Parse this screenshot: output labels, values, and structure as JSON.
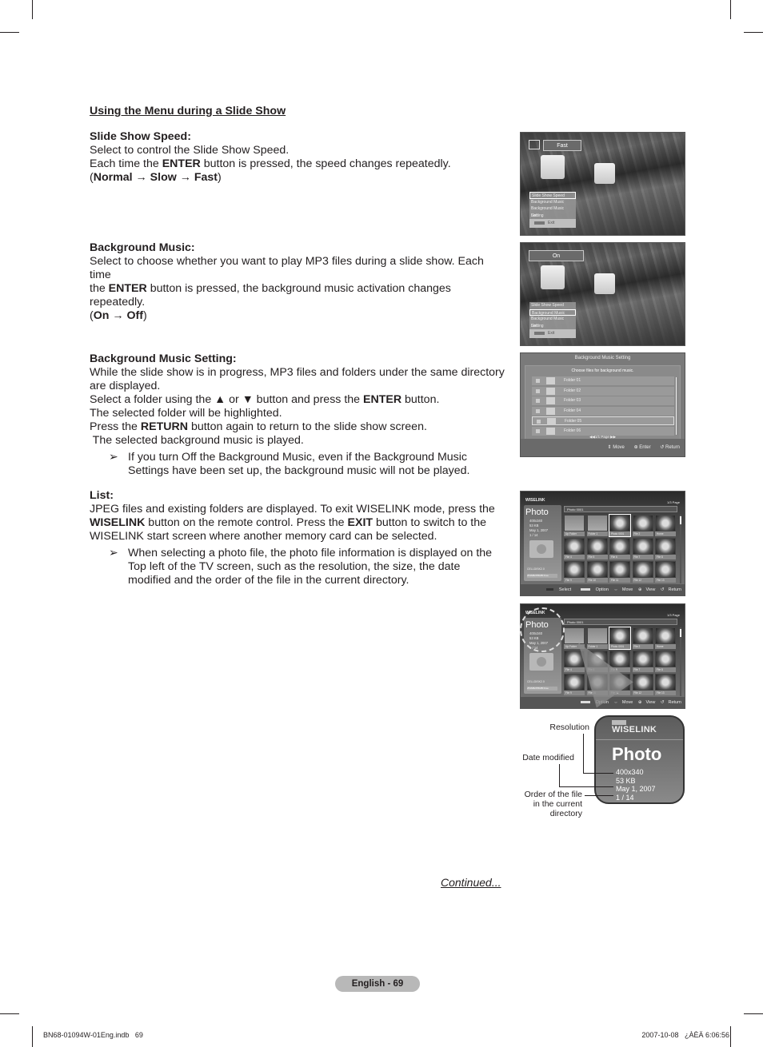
{
  "section_title": "Using the Menu during a Slide Show",
  "slide_show_speed": {
    "heading": "Slide Show Speed:",
    "line1": "Select to control the Slide Show Speed.",
    "line2_pre": "Each time the ",
    "line2_bold": "ENTER",
    "line2_post": " button is pressed, the speed changes repeatedly.",
    "cycle_open": "(",
    "cycle_bold": "Normal → Slow → Fast",
    "cycle_close": ")"
  },
  "background_music": {
    "heading": "Background Music:",
    "line1": "Select to choose whether you want to play MP3 files during a slide show. Each time",
    "line2_pre": "the ",
    "line2_bold": "ENTER",
    "line2_post": " button is pressed, the background music activation changes repeatedly.",
    "cycle_open": "(",
    "cycle_bold": "On → Off",
    "cycle_close": ")"
  },
  "background_music_setting": {
    "heading": "Background Music Setting:",
    "line1": "While the slide show is in progress, MP3 files and folders under the same directory are displayed.",
    "line2_pre": "Select a folder using the ▲ or ▼ button and press the ",
    "line2_bold": "ENTER",
    "line2_post": " button.",
    "line3": "The selected folder will be highlighted.",
    "line4_pre": "Press the ",
    "line4_bold": "RETURN",
    "line4_post": " button again to return to the slide show screen.",
    "line5": " The selected background music is played.",
    "note_arrow": "➢",
    "note": "If you turn Off the Background Music, even if the Background Music Settings have been set up, the background music will not be played."
  },
  "list": {
    "heading": "List:",
    "line1": "JPEG files and existing folders are displayed. To exit WISELINK mode, press the ",
    "line1_bold_wiselink": "WISELINK",
    "line1_mid": " button on the remote control. Press the ",
    "line1_bold_exit": "EXIT",
    "line1_post": " button to switch to the WISELINK start screen where another memory card can be selected.",
    "note_arrow": "➢",
    "note": "When selecting a photo file, the photo file information is displayed on the Top left of the TV screen, such as the resolution, the size, the date modified and the order of the file in the current directory."
  },
  "screen_speed": {
    "value": "Fast",
    "menu": [
      "Slide Show Speed",
      "Background Music",
      "Background Music Setting",
      "List"
    ],
    "selected_index": 0,
    "exit_key": "INFO",
    "exit_label": "Exit"
  },
  "screen_music": {
    "value": "On",
    "menu": [
      "Slide Show Speed",
      "Background Music",
      "Background Music Setting",
      "List"
    ],
    "selected_index": 1,
    "exit_key": "INFO",
    "exit_label": "Exit"
  },
  "screen_bms": {
    "title": "Background Music Setting",
    "subtitle": "Choose files for background music.",
    "folders": [
      "Folder 01",
      "Folder 02",
      "Folder 03",
      "Folder 04",
      "Folder 05",
      "Folder 06"
    ],
    "highlighted_index": 4,
    "page": "◀◀1/1 Page ▶▶",
    "footer": [
      "⇕ Move",
      "⊕ Enter",
      "↺ Return"
    ]
  },
  "screen_wiselink": {
    "logo": "WISELINK",
    "mode": "Photo",
    "info": [
      "400x340",
      "53 KB",
      "May 1, 2007",
      "1 / 14"
    ],
    "card": "CELLDISK2.0",
    "storage": "253MB/255MB Free",
    "path": "Photo 0001",
    "page_nav": "1/3 Page",
    "thumbs": [
      "Up Folder",
      "Folder 1",
      "Photo 0001",
      "File 2",
      "Home",
      "File 4",
      "File 5",
      "File 6",
      "File 7",
      "File 8",
      "File 9",
      "File 10",
      "File 11",
      "File 12",
      "File 13"
    ],
    "selected_index": 2,
    "footer": [
      "Select",
      "Option",
      "Move",
      "View",
      "Return"
    ],
    "footer_option_key": "INFO"
  },
  "callouts": {
    "logo": "WISELINK",
    "mode": "Photo",
    "info": [
      "400x340",
      "53 KB",
      "May 1, 2007",
      "1 / 14"
    ],
    "resolution": "Resolution",
    "date_modified": "Date modified",
    "order_line1": "Order of the file",
    "order_line2": "in the current",
    "order_line3": "directory"
  },
  "continued": "Continued...",
  "page_badge": "English - 69",
  "footer_left": "BN68-01094W-01Eng.indb   69",
  "footer_right": "2007-10-08   ¿ÀÈÄ 6:06:56"
}
